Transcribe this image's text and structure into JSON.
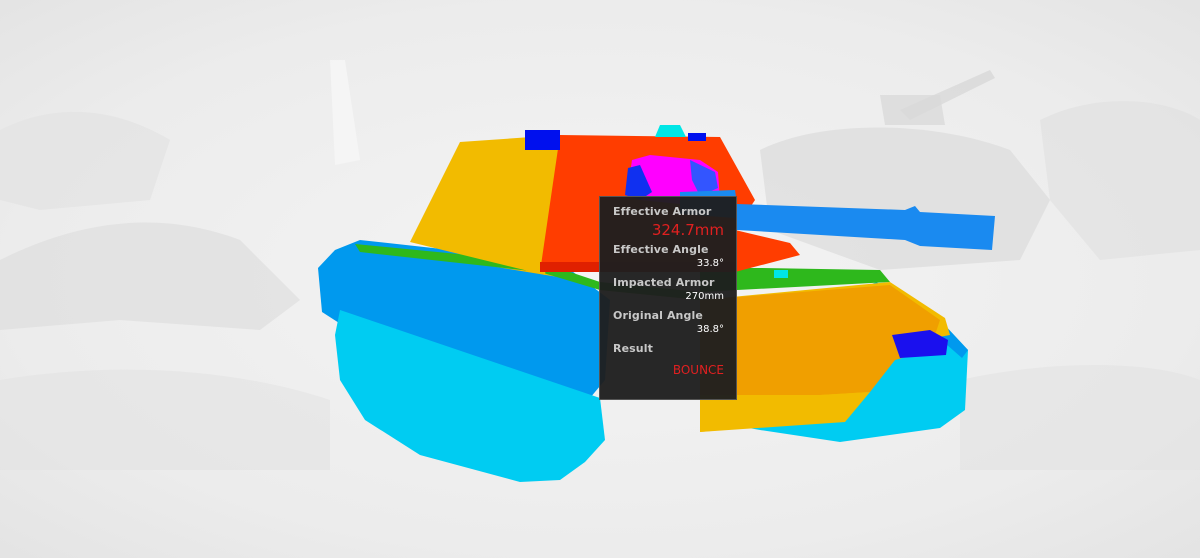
{
  "tooltip": {
    "effective_armor_label": "Effective Armor",
    "effective_armor_value": "324.7mm",
    "effective_angle_label": "Effective Angle",
    "effective_angle_value": "33.8°",
    "impacted_armor_label": "Impacted Armor",
    "impacted_armor_value": "270mm",
    "original_angle_label": "Original Angle",
    "original_angle_value": "38.8°",
    "result_label": "Result",
    "result_value": "BOUNCE"
  },
  "colors": {
    "background": "#ededed",
    "track_light": "#00ccf2",
    "track_dark": "#0099ee",
    "hull_yellow": "#f2bb00",
    "hull_orange": "#f09f00",
    "turret_red": "#ff3d00",
    "hull_green": "#2eb81c",
    "gun_blue": "#1a8af0",
    "mantlet_magenta": "#ff00ff",
    "cupola_blue": "#0010ee",
    "periscope_cyan": "#00e6e6",
    "result_red": "#e02020"
  }
}
